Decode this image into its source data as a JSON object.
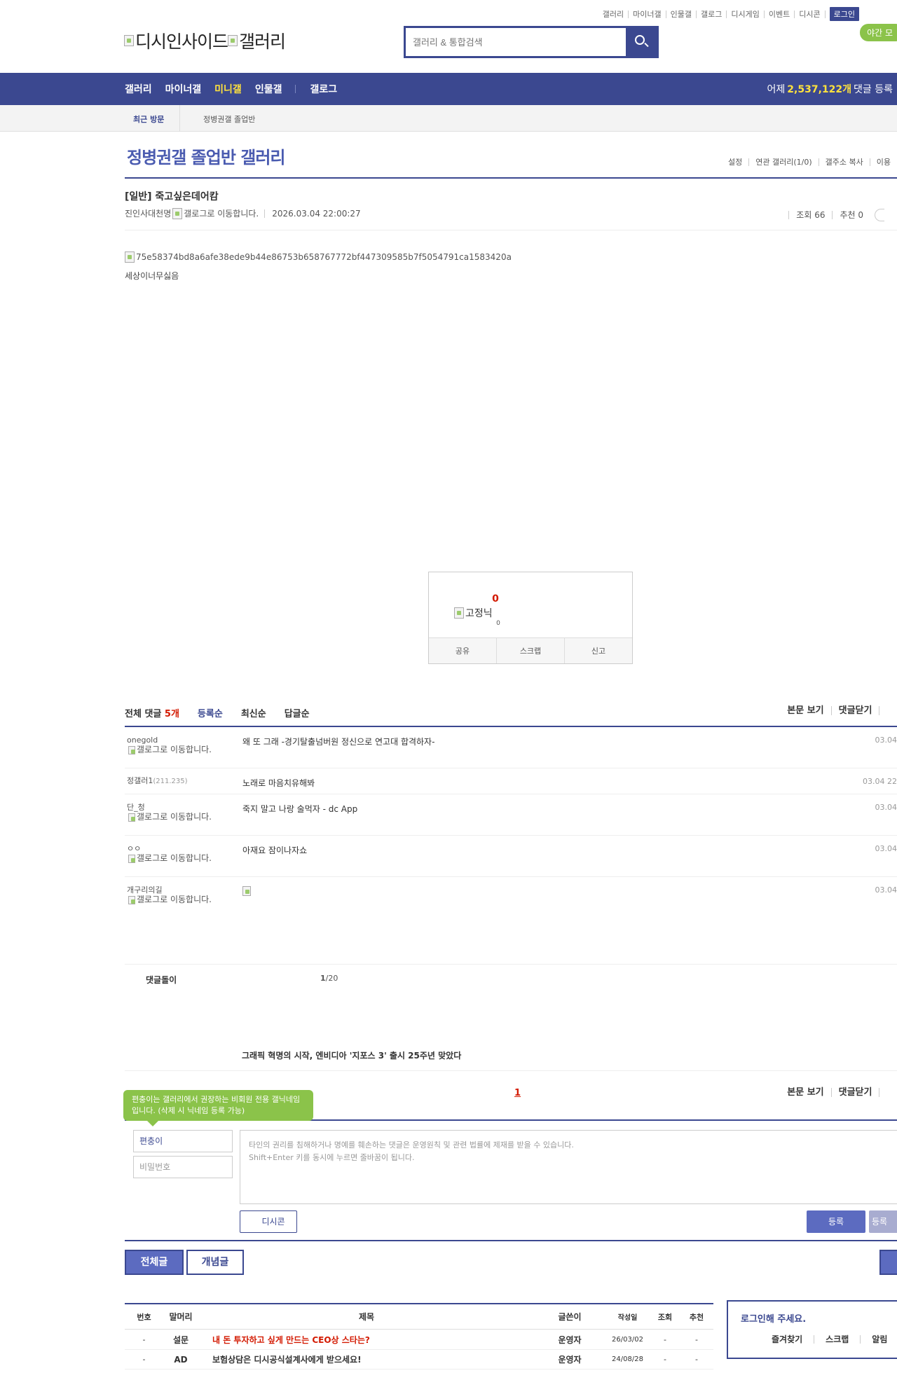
{
  "top_links": [
    "갤러리",
    "마이너갤",
    "인물갤",
    "갤로그",
    "디시게임",
    "이벤트",
    "디시콘"
  ],
  "login_label": "로그인",
  "night_mode_label": "야간 모",
  "logo_alt_1": "디시인사이드",
  "logo_alt_2": "갤러리",
  "search": {
    "placeholder": "갤러리 & 통합검색"
  },
  "nav": {
    "items": [
      "갤러리",
      "마이너갤",
      "미니갤",
      "인물갤",
      "갤로그"
    ],
    "active_index": 2,
    "yesterday_prefix": "어제",
    "yesterday_count": "2,537,122개",
    "yesterday_suffix": "댓글 등록"
  },
  "recent": {
    "label": "최근 방문",
    "item": "정병권갤 졸업반"
  },
  "gallery": {
    "title": "정병권갤 졸업반 갤러리",
    "tools": [
      "설정",
      "연관 갤러리(1/0)",
      "갤주소 복사",
      "이용"
    ]
  },
  "post": {
    "title": "[일반] 죽고싶은데어캄",
    "author": "진인사대천명",
    "gallog_alt": "갤로그로 이동합니다.",
    "date": "2026.03.04 22:00:27",
    "views": "조회 66",
    "recommend": "추천 0",
    "image_alt": "75e58374bd8a6afe38ede9b44e86753b658767772bf447309585b7f5054791ca1583420a",
    "body": "세상이너무싫음"
  },
  "recommend_box": {
    "count": "0",
    "fixed_alt": "고정닉",
    "fixed_count": "0",
    "buttons": [
      "공유",
      "스크랩",
      "신고"
    ]
  },
  "comments": {
    "total_label": "전체 댓글",
    "total_count": "5개",
    "sort_tabs": [
      "등록순",
      "최신순",
      "답글순"
    ],
    "right_tools": [
      "본문 보기",
      "댓글닫기"
    ],
    "items": [
      {
        "name": "onegold",
        "ip": "",
        "gallog": "갤로그로 이동합니다.",
        "text": "왜 또 그래 -경기탈출넘버원 정신으로 연고대 합격하자-",
        "date": "03.04"
      },
      {
        "name": "정갤러1",
        "ip": "(211.235)",
        "gallog": "",
        "text": "노래로 마음치유해봐",
        "date": "03.04 22"
      },
      {
        "name": "단_청",
        "ip": "",
        "gallog": "갤로그로 이동합니다.",
        "text": "죽지 말고 나랑 술먹자 - dc App",
        "date": "03.04"
      },
      {
        "name": "ㅇㅇ",
        "ip": "",
        "gallog": "갤로그로 이동합니다.",
        "text": "아재요 잠이나자쇼",
        "date": "03.04"
      },
      {
        "name": "개구리의길",
        "ip": "",
        "gallog": "갤로그로 이동합니다.",
        "text": "",
        "date": "03.04"
      }
    ],
    "reply_bot_label": "댓글돌이",
    "reply_page": "1",
    "reply_page_total": "/20",
    "ad_headline": "그래픽 혁명의 시작, 엔비디아 '지포스 3' 출시 25주년 맞았다",
    "page_current": "1"
  },
  "write": {
    "tooltip": "편충이는 갤러리에서 권장하는 비회원 전용 갤닉네임입니다. (삭제 시 닉네임 등록 가능)",
    "nickname": "편충이",
    "password_placeholder": "비밀번호",
    "textarea_line1": "타인의 권리를 침해하거나 명예를 훼손하는 댓글은 운영원칙 및 관련 법률에 제재를 받을 수 있습니다.",
    "textarea_line2": "Shift+Enter 키를 동시에 누르면 줄바꿈이 됩니다.",
    "dccon_label": "디시콘",
    "submit_label": "등록",
    "submit2_label": "등록"
  },
  "list_tabs": {
    "all": "전체글",
    "concept": "개념글"
  },
  "list": {
    "headers": [
      "번호",
      "말머리",
      "제목",
      "글쓴이",
      "작성일",
      "조회",
      "추천"
    ],
    "rows": [
      {
        "no": "-",
        "tag": "설문",
        "subject": "내 돈 투자하고 싶게 만드는 CEO상 스타는?",
        "writer": "운영자",
        "date": "26/03/02",
        "views": "-",
        "rec": "-",
        "highlight": true
      },
      {
        "no": "-",
        "tag": "AD",
        "subject": "보험상담은 디시공식설계사에게 받으세요!",
        "writer": "운영자",
        "date": "24/08/28",
        "views": "-",
        "rec": "-",
        "highlight": false
      }
    ]
  },
  "login_box": {
    "title": "로그인해 주세요.",
    "links": [
      "즐겨찾기",
      "스크랩",
      "알림"
    ]
  },
  "colors": {
    "brand": "#3b4890",
    "highlight": "#d31900",
    "accent_green": "#8bc34a",
    "nav_active": "#ffe23d"
  }
}
